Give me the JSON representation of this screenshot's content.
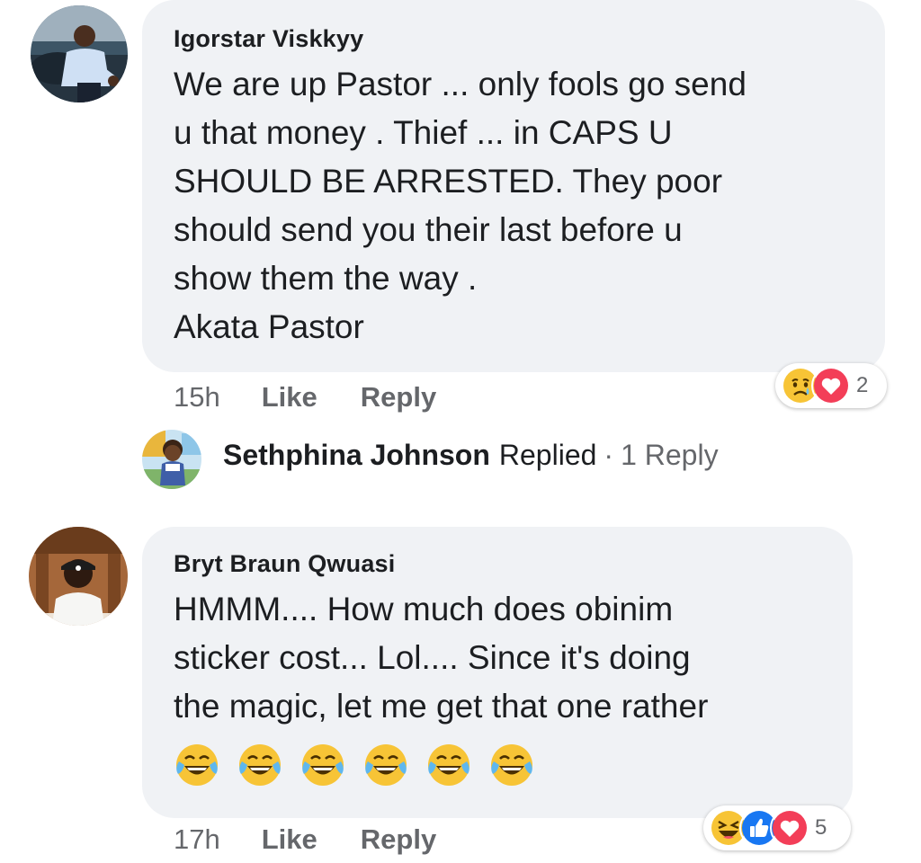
{
  "comments": [
    {
      "author": "Igorstar Viskkyy",
      "lines": [
        "We are up Pastor ... only fools go send",
        "u that money . Thief ... in CAPS U",
        "SHOULD BE ARRESTED.  They poor",
        "should send you their last before u",
        "show them the way .",
        "Akata Pastor"
      ],
      "time": "15h",
      "like_label": "Like",
      "reply_label": "Reply",
      "reactions": {
        "icons": [
          "sad-reaction-icon",
          "love-reaction-icon"
        ],
        "count": "2"
      },
      "reply_summary": {
        "name": "Sethphina Johnson",
        "verb": "Replied",
        "separator": "·",
        "count_text": "1 Reply"
      }
    },
    {
      "author": "Bryt Braun Qwuasi",
      "lines": [
        "HMMM.... How much does obinim",
        "sticker cost... Lol.... Since it's doing",
        "the magic, let me get that one rather"
      ],
      "emoji": [
        "laughing-tears-emoji",
        "laughing-tears-emoji",
        "laughing-tears-emoji",
        "laughing-tears-emoji",
        "laughing-tears-emoji",
        "laughing-tears-emoji"
      ],
      "time": "17h",
      "like_label": "Like",
      "reply_label": "Reply",
      "reactions": {
        "icons": [
          "haha-reaction-icon",
          "like-reaction-icon",
          "love-reaction-icon"
        ],
        "count": "5"
      }
    }
  ],
  "colors": {
    "bubble": "#f0f2f5",
    "muted_text": "#65676b",
    "like_blue": "#1877f2",
    "love_red": "#f33e58",
    "emoji_yellow": "#f7c436"
  }
}
